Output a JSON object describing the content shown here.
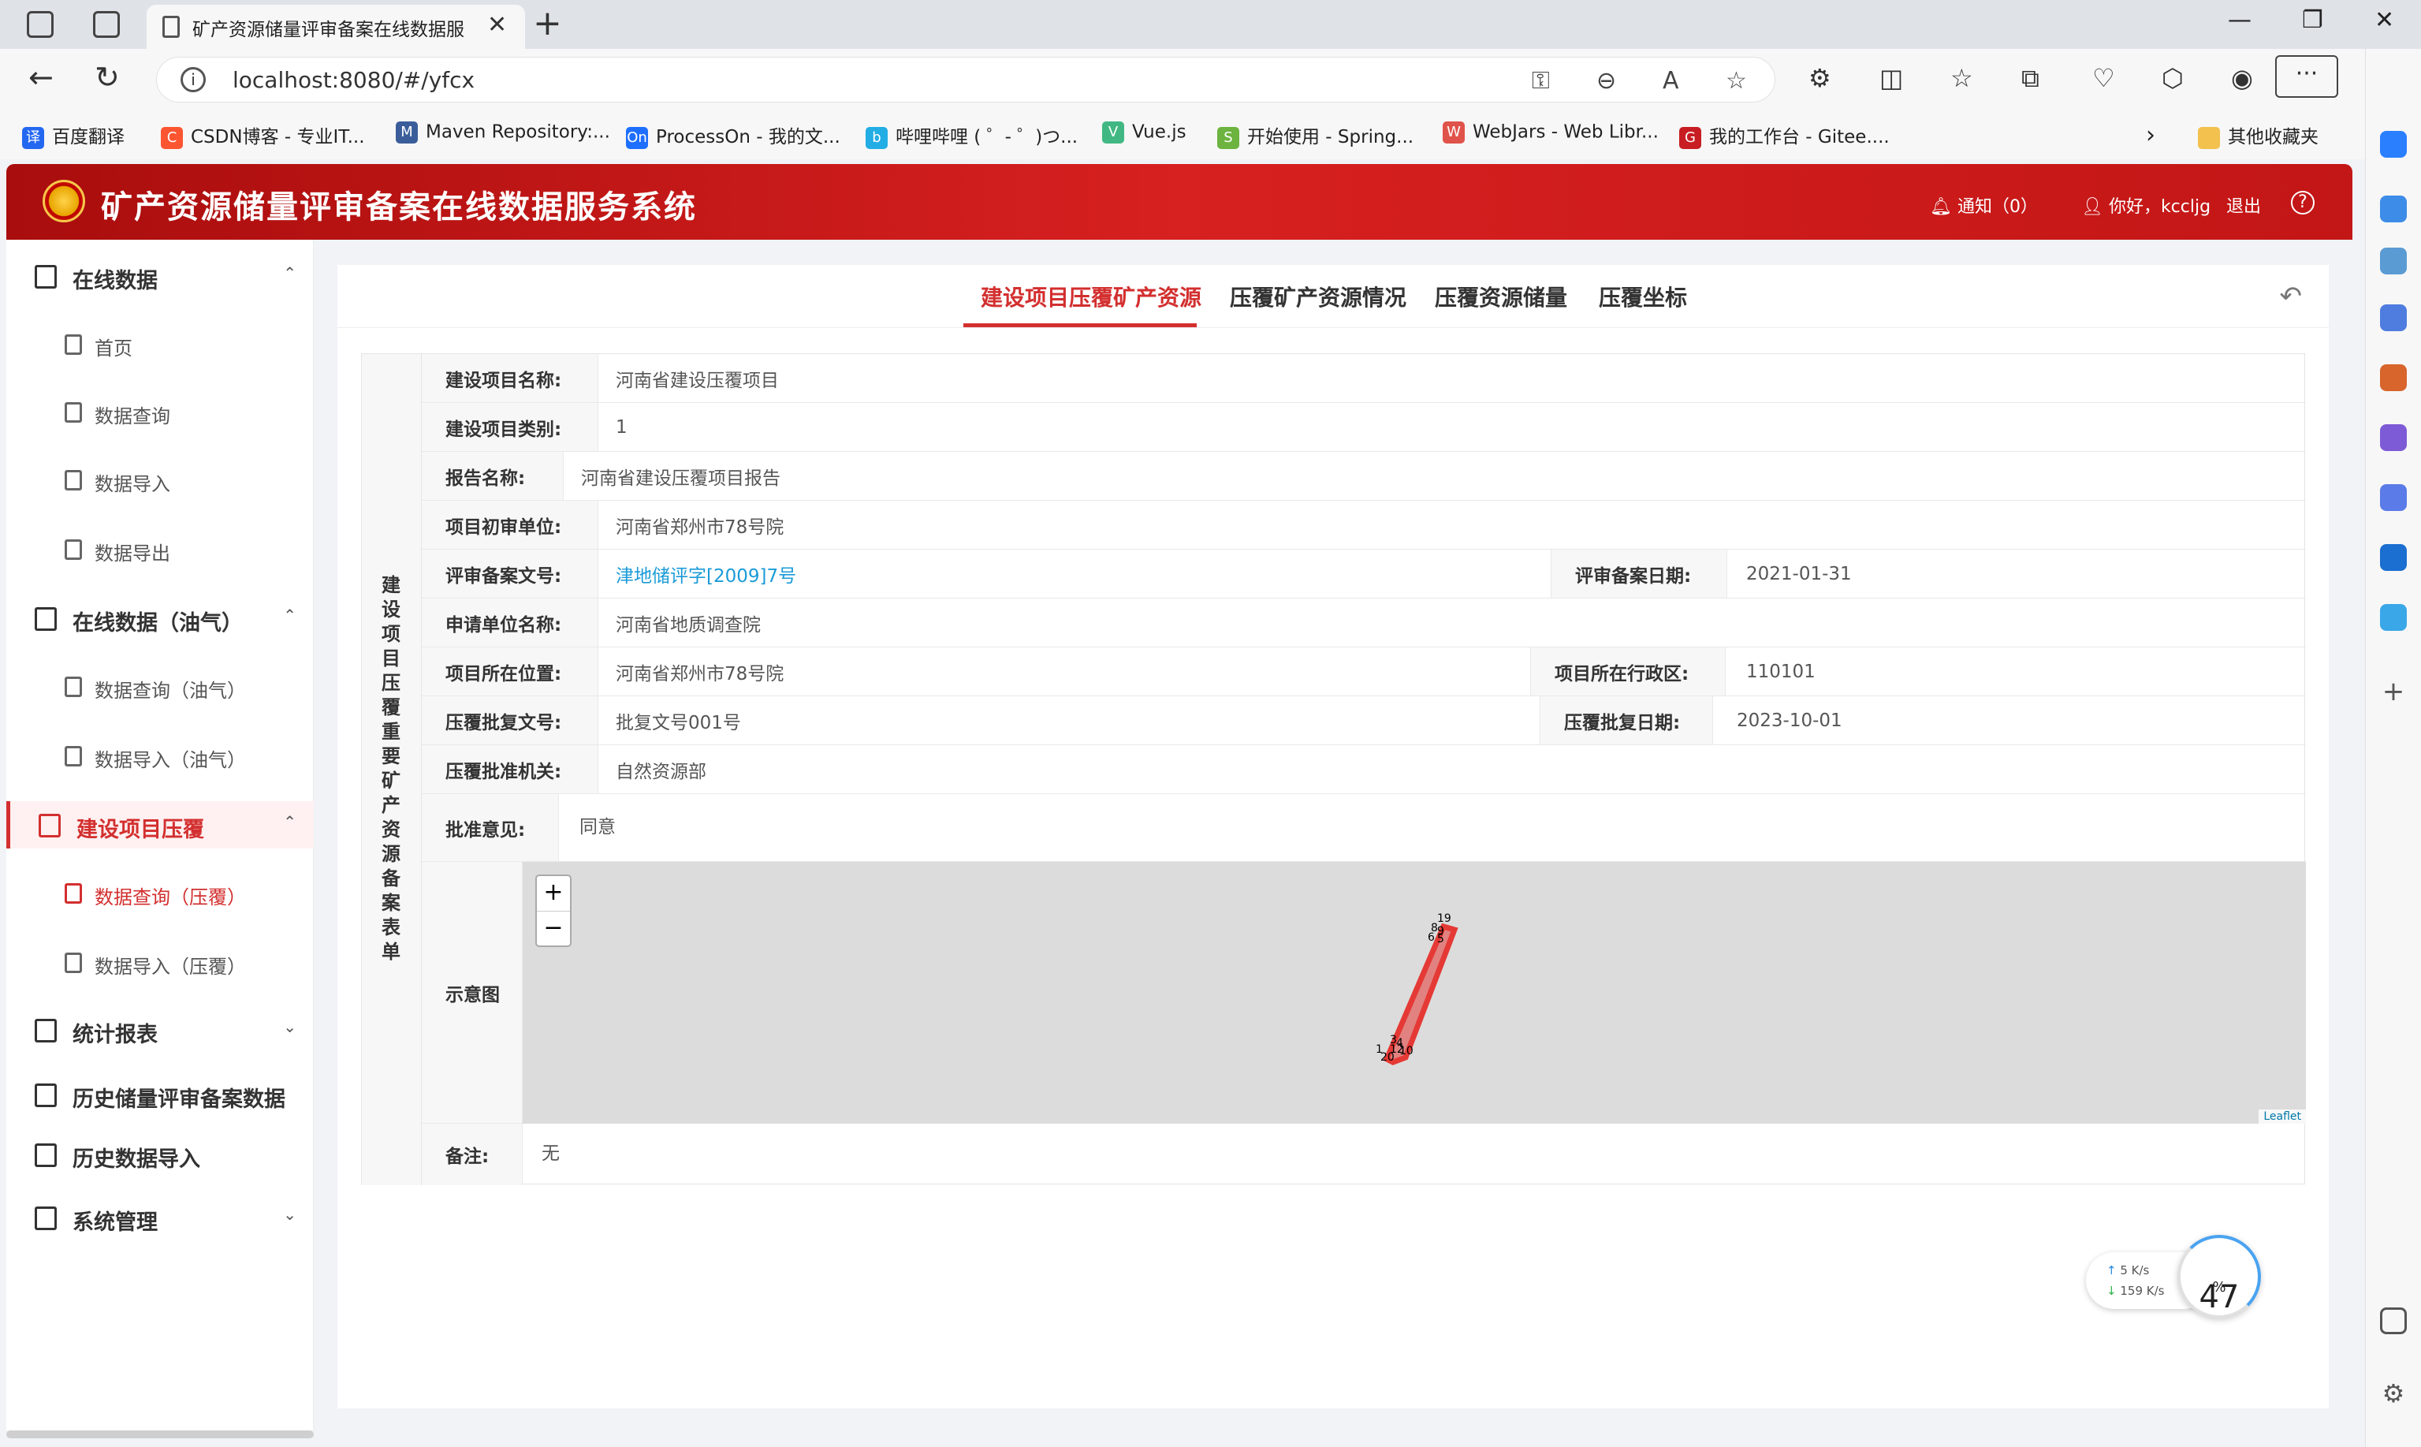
{
  "browser": {
    "tab_title": "矿产资源储量评审备案在线数据服",
    "url": "localhost:8080/#/yfcx",
    "bookmarks": [
      {
        "label": "百度翻译",
        "fav": "译",
        "color": "#2468f2"
      },
      {
        "label": "CSDN博客 - 专业IT...",
        "fav": "C",
        "color": "#fc5531"
      },
      {
        "label": "Maven Repository:...",
        "fav": "M",
        "color": "#3b5e9a"
      },
      {
        "label": "ProcessOn - 我的文...",
        "fav": "On",
        "color": "#1e6fff"
      },
      {
        "label": "哔哩哔哩 ( ゜- ゜)つ...",
        "fav": "b",
        "color": "#23ade5"
      },
      {
        "label": "Vue.js",
        "fav": "V",
        "color": "#41b883"
      },
      {
        "label": "开始使用 - Spring...",
        "fav": "S",
        "color": "#6db33f"
      },
      {
        "label": "WebJars - Web Libr...",
        "fav": "W",
        "color": "#e0534a"
      },
      {
        "label": "我的工作台 - Gitee....",
        "fav": "G",
        "color": "#c71d23"
      }
    ],
    "other_bookmarks": "其他收藏夹"
  },
  "header": {
    "title": "矿产资源储量评审备案在线数据服务系统",
    "notice": "通知（0）",
    "greeting": "你好，kccljg",
    "logout": "退出"
  },
  "sidebar": {
    "groups": [
      {
        "label": "在线数据",
        "items": [
          "首页",
          "数据查询",
          "数据导入",
          "数据导出"
        ]
      },
      {
        "label": "在线数据（油气）",
        "items": [
          "数据查询（油气）",
          "数据导入（油气）"
        ]
      },
      {
        "label": "建设项目压覆",
        "items": [
          "数据查询（压覆）",
          "数据导入（压覆）"
        ],
        "active": true
      },
      {
        "label": "统计报表"
      },
      {
        "label": "历史储量评审备案数据"
      },
      {
        "label": "历史数据导入"
      },
      {
        "label": "系统管理"
      }
    ]
  },
  "tabs": [
    "建设项目压覆矿产资源",
    "压覆矿产资源情况",
    "压覆资源储量",
    "压覆坐标"
  ],
  "form": {
    "side_title": "建设项目压覆重要矿产资源备案表单",
    "project_name_label": "建设项目名称:",
    "project_name": "河南省建设压覆项目",
    "project_type_label": "建设项目类别:",
    "project_type": "1",
    "report_name_label": "报告名称:",
    "report_name": "河南省建设压覆项目报告",
    "first_review_label": "项目初审单位:",
    "first_review": "河南省郑州市78号院",
    "review_doc_label": "评审备案文号:",
    "review_doc": "津地储评字[2009]7号",
    "review_date_label": "评审备案日期:",
    "review_date": "2021-01-31",
    "applicant_label": "申请单位名称:",
    "applicant": "河南省地质调查院",
    "location_label": "项目所在位置:",
    "location": "河南省郑州市78号院",
    "district_label": "项目所在行政区:",
    "district": "110101",
    "approval_doc_label": "压覆批复文号:",
    "approval_doc": "批复文号001号",
    "approval_date_label": "压覆批复日期:",
    "approval_date": "2023-10-01",
    "authority_label": "压覆批准机关:",
    "authority": "自然资源部",
    "opinion_label": "批准意见:",
    "opinion": "同意",
    "map_label": "示意图",
    "remark_label": "备注:",
    "remark": "无"
  },
  "map": {
    "zoom_in": "+",
    "zoom_out": "−",
    "attribution": "Leaflet",
    "polygon_color": "#e53935",
    "point_labels": [
      "19",
      "8",
      "9",
      "6",
      "5",
      "1",
      "20",
      "3",
      "4",
      "12",
      "10"
    ]
  },
  "net_widget": {
    "up": "5  K/s",
    "down": "159 K/s",
    "percent": "47",
    "unit": "%"
  }
}
